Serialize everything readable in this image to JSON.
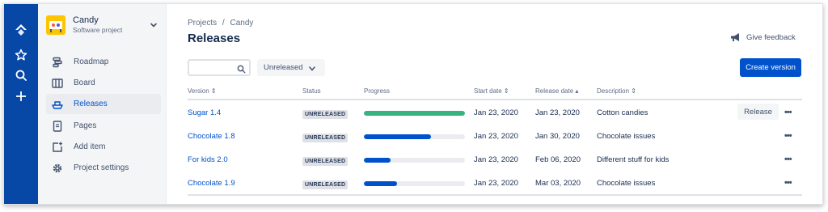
{
  "colors": {
    "global_nav": "#0747a6",
    "accent": "#0052cc",
    "progress_done": "#36b37e",
    "progress_partial": "#0052cc"
  },
  "global_nav": {
    "icons": [
      "jira-logo-icon",
      "star-icon",
      "search-icon",
      "plus-icon"
    ]
  },
  "project": {
    "name": "Candy",
    "type": "Software project"
  },
  "sidebar": {
    "items": [
      {
        "label": "Roadmap",
        "icon": "roadmap-icon"
      },
      {
        "label": "Board",
        "icon": "board-icon"
      },
      {
        "label": "Releases",
        "icon": "ship-icon"
      },
      {
        "label": "Pages",
        "icon": "page-icon"
      },
      {
        "label": "Add item",
        "icon": "add-item-icon"
      },
      {
        "label": "Project settings",
        "icon": "gear-icon"
      }
    ]
  },
  "breadcrumb": {
    "root": "Projects",
    "separator": "/",
    "current": "Candy"
  },
  "page": {
    "title": "Releases"
  },
  "feedback": {
    "label": "Give feedback"
  },
  "search": {
    "value": "",
    "placeholder": ""
  },
  "filter": {
    "selected": "Unreleased"
  },
  "create_button": {
    "label": "Create version"
  },
  "table": {
    "headers": {
      "version": "Version",
      "status": "Status",
      "progress": "Progress",
      "start": "Start date",
      "release": "Release date",
      "description": "Description"
    },
    "rows": [
      {
        "version": "Sugar 1.4",
        "status": "UNRELEASED",
        "progress": 1.0,
        "start": "Jan 23, 2020",
        "release": "Jan 23, 2020",
        "description": "Cotton candies",
        "action": "Release"
      },
      {
        "version": "Chocolate 1.8",
        "status": "UNRELEASED",
        "progress": 0.66,
        "start": "Jan 23, 2020",
        "release": "Jan 30, 2020",
        "description": "Chocolate issues"
      },
      {
        "version": "For kids 2.0",
        "status": "UNRELEASED",
        "progress": 0.26,
        "start": "Jan 23, 2020",
        "release": "Feb 06, 2020",
        "description": "Different stuff for kids"
      },
      {
        "version": "Chocolate 1.9",
        "status": "UNRELEASED",
        "progress": 0.33,
        "start": "Jan 23, 2020",
        "release": "Mar 03, 2020",
        "description": "Chocolate issues"
      }
    ]
  }
}
